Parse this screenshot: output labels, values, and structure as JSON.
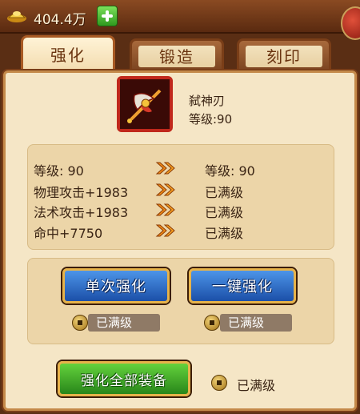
{
  "topbar": {
    "gold_amount": "404.4万",
    "icons": {
      "currency": "gold-ingot-icon",
      "add": "plus-icon"
    }
  },
  "tabs": [
    {
      "label": "强化",
      "active": true
    },
    {
      "label": "锻造",
      "active": false
    },
    {
      "label": "刻印",
      "active": false
    }
  ],
  "item": {
    "name": "弑神刃",
    "level": "等级:90",
    "icon": "blade-weapon-icon"
  },
  "stats": [
    {
      "current": "等级: 90",
      "next": "等级: 90"
    },
    {
      "current": "物理攻击+1983",
      "next": "已满级"
    },
    {
      "current": "法术攻击+1983",
      "next": "已满级"
    },
    {
      "current": "命中+7750",
      "next": "已满级"
    }
  ],
  "actions": {
    "single_label": "单次强化",
    "single_cost": "已满级",
    "onekey_label": "一键强化",
    "onekey_cost": "已满级",
    "all_label": "强化全部装备",
    "all_cost": "已满级"
  },
  "colors": {
    "panel_bg": "#f5e6c6",
    "blue_button": "#1b4fa8",
    "green_button": "#28861a",
    "item_border": "#c0281c"
  }
}
